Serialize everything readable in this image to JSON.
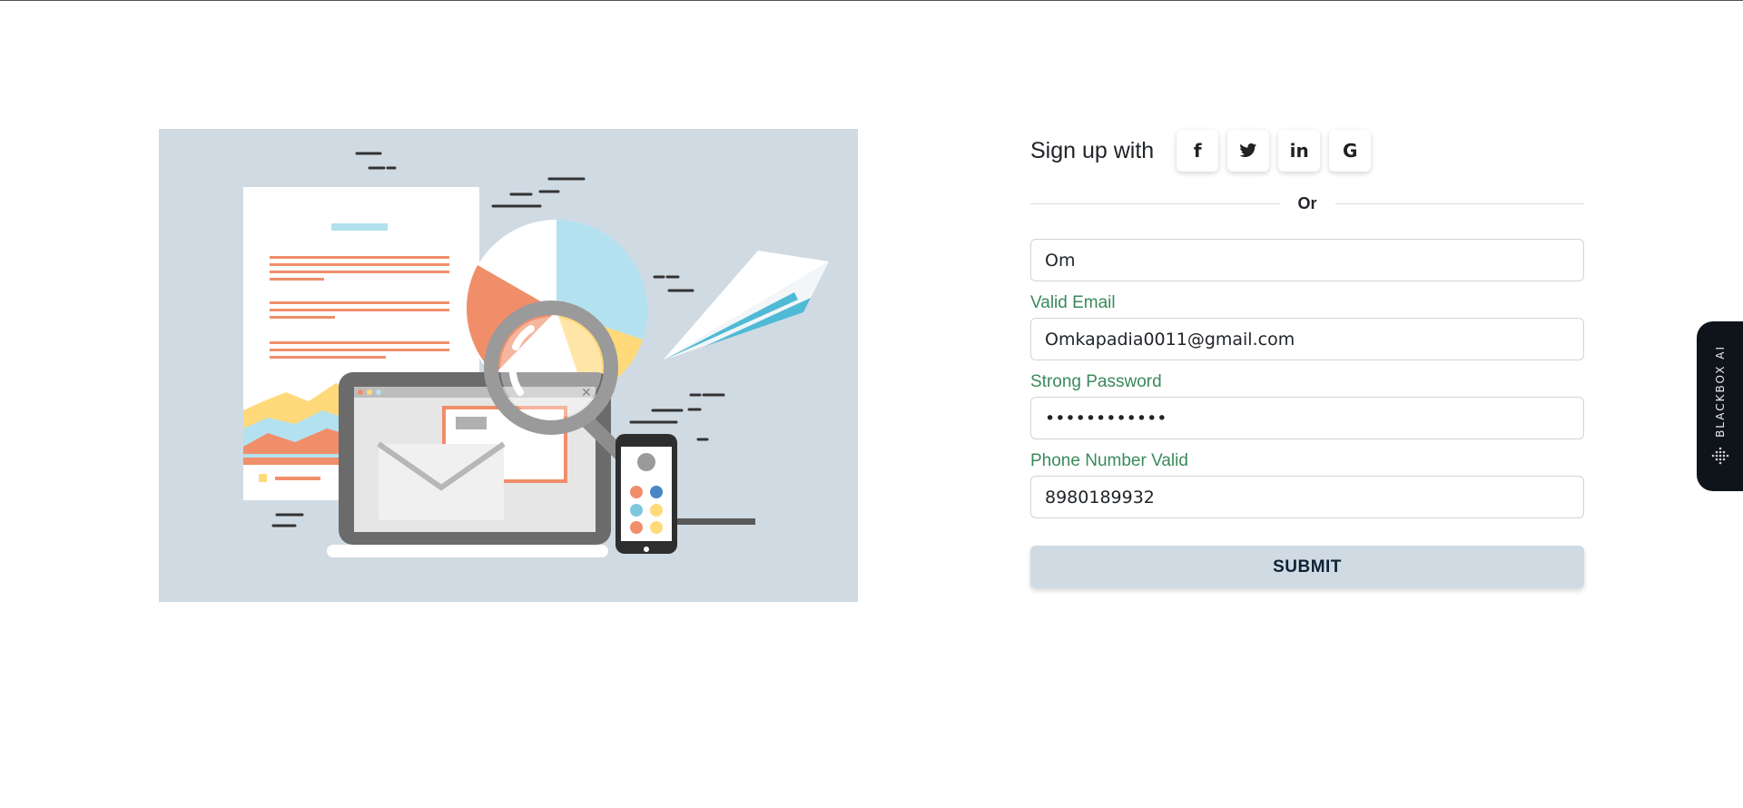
{
  "social": {
    "label": "Sign up with",
    "buttons": [
      {
        "name": "facebook",
        "glyph": "f"
      },
      {
        "name": "twitter",
        "glyph": "t"
      },
      {
        "name": "linkedin",
        "glyph": "in"
      },
      {
        "name": "google",
        "glyph": "G"
      }
    ]
  },
  "divider": {
    "text": "Or"
  },
  "form": {
    "name_value": "Om",
    "email_label": "Valid Email",
    "email_value": "Omkapadia0011@gmail.com",
    "password_label": "Strong Password",
    "password_value": "Omkapadia11!",
    "phone_label": "Phone Number Valid",
    "phone_value": "8980189932",
    "submit_label": "SUBMIT"
  },
  "widget": {
    "label": "BLACKBOX AI"
  },
  "colors": {
    "illustration_bg": "#d0dae3",
    "label_green": "#3a8a5a",
    "submit_bg": "#d0dae3",
    "widget_bg": "#0f141a"
  }
}
